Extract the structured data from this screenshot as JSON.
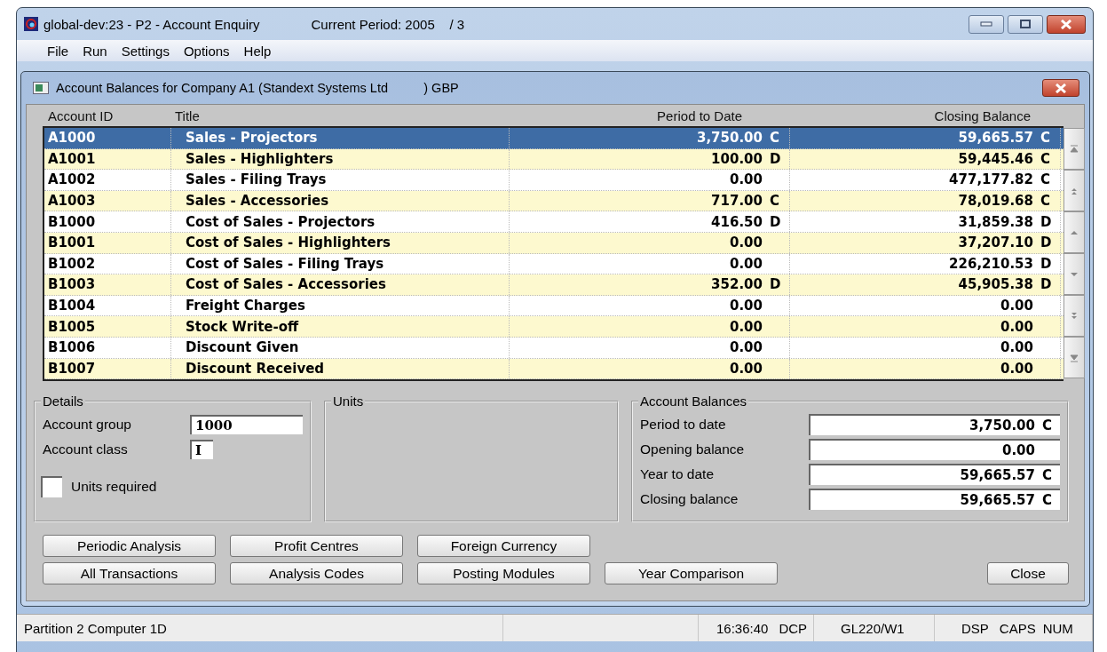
{
  "window": {
    "title": "global-dev:23 - P2 - Account Enquiry",
    "period": "Current Period: 2005    / 3"
  },
  "menu": [
    "File",
    "Run",
    "Settings",
    "Options",
    "Help"
  ],
  "dialog": {
    "title": "Account Balances for Company A1 (Standext Systems Ltd          ) GBP"
  },
  "table": {
    "columns": [
      "Account ID",
      "Title",
      "Period to Date",
      "Closing Balance"
    ],
    "rows": [
      {
        "id": "A1000",
        "title": "Sales - Projectors",
        "ptd": "3,750.00",
        "ptd_side": "C",
        "closing": "59,665.57",
        "closing_side": "C",
        "selected": true
      },
      {
        "id": "A1001",
        "title": "Sales - Highlighters",
        "ptd": "100.00",
        "ptd_side": "D",
        "closing": "59,445.46",
        "closing_side": "C",
        "selected": false
      },
      {
        "id": "A1002",
        "title": "Sales - Filing Trays",
        "ptd": "0.00",
        "closing": "477,177.82",
        "closing_side": "C",
        "selected": false
      },
      {
        "id": "A1003",
        "title": "Sales - Accessories",
        "ptd": "717.00",
        "ptd_side": "C",
        "closing": "78,019.68",
        "closing_side": "C",
        "selected": false
      },
      {
        "id": "B1000",
        "title": "Cost of Sales - Projectors",
        "ptd": "416.50",
        "ptd_side": "D",
        "closing": "31,859.38",
        "closing_side": "D",
        "selected": false
      },
      {
        "id": "B1001",
        "title": "Cost of Sales - Highlighters",
        "ptd": "0.00",
        "closing": "37,207.10",
        "closing_side": "D",
        "selected": false
      },
      {
        "id": "B1002",
        "title": "Cost of Sales - Filing Trays",
        "ptd": "0.00",
        "closing": "226,210.53",
        "closing_side": "D",
        "selected": false
      },
      {
        "id": "B1003",
        "title": "Cost of Sales - Accessories",
        "ptd": "352.00",
        "ptd_side": "D",
        "closing": "45,905.38",
        "closing_side": "D",
        "selected": false
      },
      {
        "id": "B1004",
        "title": "Freight Charges",
        "ptd": "0.00",
        "closing": "0.00",
        "selected": false
      },
      {
        "id": "B1005",
        "title": "Stock Write-off",
        "ptd": "0.00",
        "closing": "0.00",
        "selected": false
      },
      {
        "id": "B1006",
        "title": "Discount Given",
        "ptd": "0.00",
        "closing": "0.00",
        "selected": false
      },
      {
        "id": "B1007",
        "title": "Discount Received",
        "ptd": "0.00",
        "closing": "0.00",
        "selected": false
      }
    ]
  },
  "details": {
    "title": "Details",
    "fields": [
      {
        "label": "Account group",
        "value": "1000"
      },
      {
        "label": "Account class",
        "value": "I"
      }
    ],
    "units_required": {
      "label": "Units required",
      "checked": false
    }
  },
  "units": {
    "title": "Units"
  },
  "balances": {
    "title": "Account Balances",
    "fields": [
      {
        "label": "Period to date",
        "value": "3,750.00",
        "side": "C"
      },
      {
        "label": "Opening balance",
        "value": "0.00"
      },
      {
        "label": "Year to date",
        "value": "59,665.57",
        "side": "C"
      },
      {
        "label": "Closing balance",
        "value": "59,665.57",
        "side": "C"
      }
    ]
  },
  "buttons": [
    [
      "Periodic Analysis",
      "Profit Centres",
      "Foreign Currency"
    ],
    [
      "All Transactions",
      "Analysis Codes",
      "Posting Modules",
      "Year Comparison"
    ]
  ],
  "close_button": "Close",
  "status_bar": [
    "Partition 2 Computer 1D",
    "16:36:40",
    "DCP",
    "GL220/W1",
    "DSP",
    "CAPS",
    "NUM"
  ]
}
